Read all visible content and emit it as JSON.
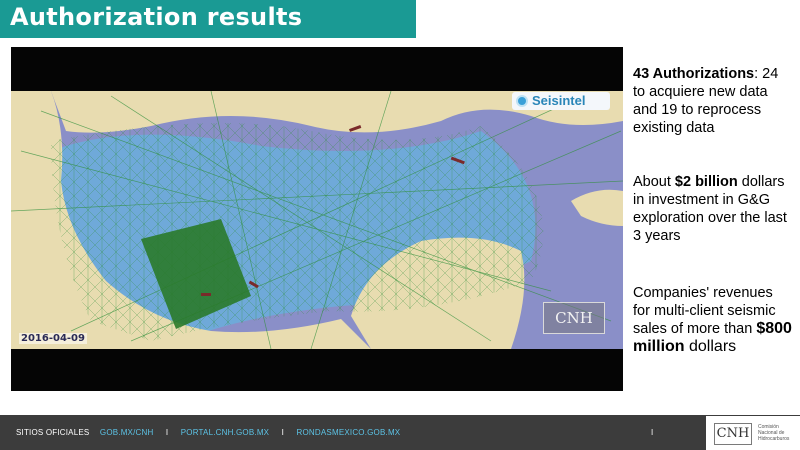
{
  "header": {
    "title": "Authorization results"
  },
  "map": {
    "logo_text": "Seisintel",
    "date": "2016-04-09",
    "watermark": "CNH",
    "colors": {
      "land": "#e8dcb0",
      "gulf": "#6fa9d9",
      "deep_water": "#8a8fc8",
      "survey_lines": "#2f8f3a",
      "survey_block": "#2a7a2a"
    }
  },
  "stats": {
    "p1": {
      "bold": "43 Authorizations",
      "text": ": 24 to acquiere new data and 19 to reprocess existing data"
    },
    "p2": {
      "pre": "About ",
      "bold": "$2 billion",
      "text": " dollars in investment in G&G exploration over the last 3 years"
    },
    "p3": {
      "pre": "Companies' revenues for multi-client seismic sales of more than ",
      "bold": "$800 million",
      "text": " dollars"
    }
  },
  "footer": {
    "label": "SITIOS OFICIALES",
    "links": [
      "GOB.MX/CNH",
      "PORTAL.CNH.GOB.MX",
      "RONDASMEXICO.GOB.MX"
    ],
    "separator": "I",
    "page_number": "I",
    "logo_text": "CNH",
    "logo_subtitle": "Comisión Nacional de Hidrocarburos"
  }
}
